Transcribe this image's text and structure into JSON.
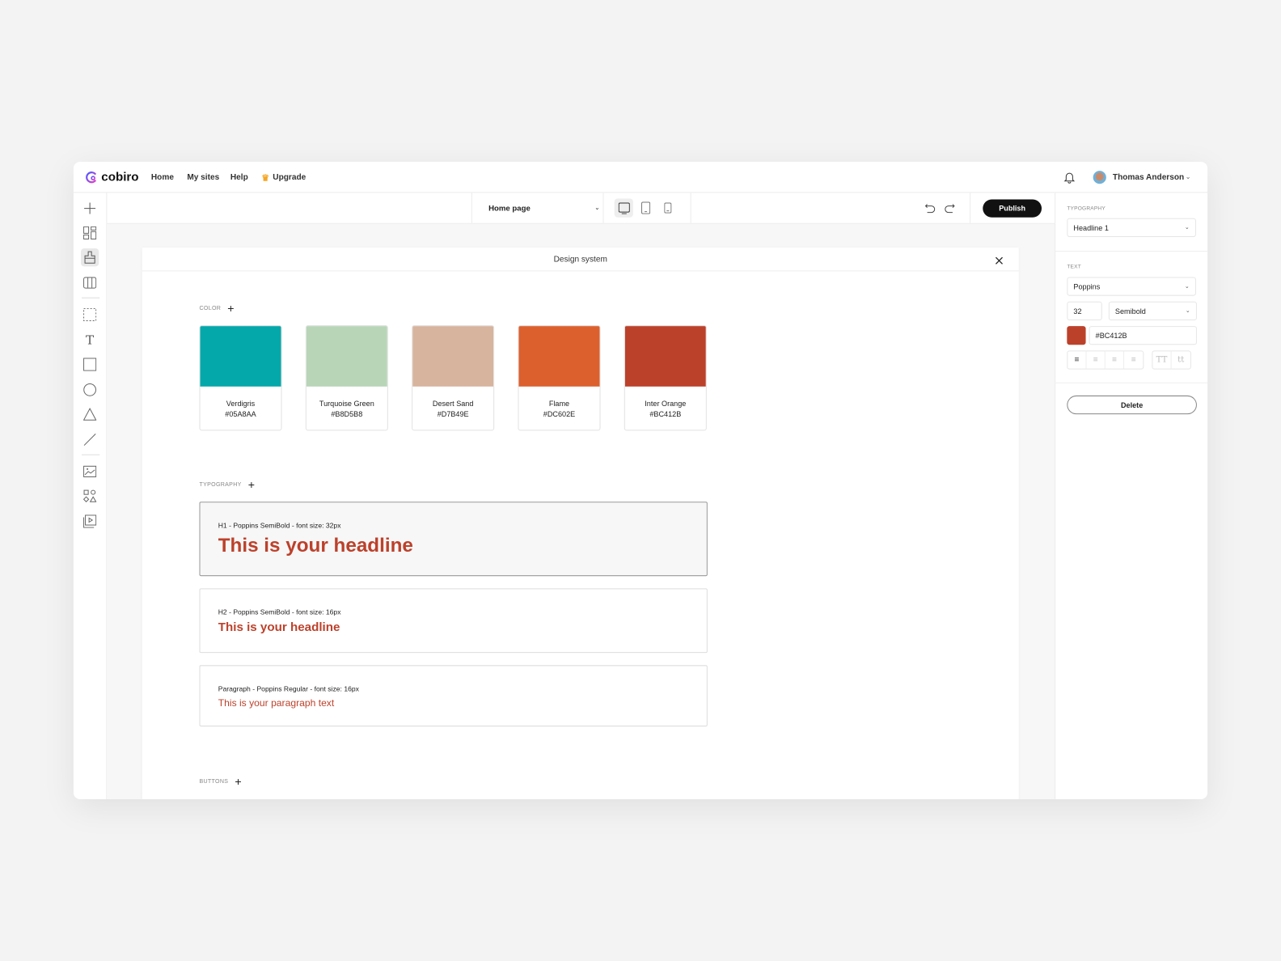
{
  "nav": {
    "brand": "cobiro",
    "items": [
      "Home",
      "My sites",
      "Help"
    ],
    "upgrade": "Upgrade",
    "user": "Thomas Anderson"
  },
  "toolbar": {
    "page_select": "Home page",
    "publish": "Publish"
  },
  "modal": {
    "title": "Design system",
    "color_label": "COLOR",
    "colors": [
      {
        "name": "Verdigris",
        "hex": "#05A8AA"
      },
      {
        "name": "Turquoise Green",
        "hex": "#B8D5B8"
      },
      {
        "name": "Desert Sand",
        "hex": "#D7B49E"
      },
      {
        "name": "Flame",
        "hex": "#DC602E"
      },
      {
        "name": "Inter Orange",
        "hex": "#BC412B"
      }
    ],
    "typography_label": "TYPOGRAPHY",
    "typography": [
      {
        "meta": "H1 - Poppins SemiBold - font size: 32px",
        "sample": "This is your headline"
      },
      {
        "meta": "H2 - Poppins SemiBold - font size: 16px",
        "sample": "This is your headline"
      },
      {
        "meta": "Paragraph - Poppins Regular - font size: 16px",
        "sample": "This is your paragraph text"
      }
    ],
    "buttons_label": "BUTTONS"
  },
  "panel": {
    "typography_label": "TYPOGRAPHY",
    "style": "Headline 1",
    "text_label": "TEXT",
    "font": "Poppins",
    "size": "32",
    "weight": "Semibold",
    "color": "#BC412B",
    "case_upper": "TT",
    "case_lower": "tt",
    "delete": "Delete"
  }
}
